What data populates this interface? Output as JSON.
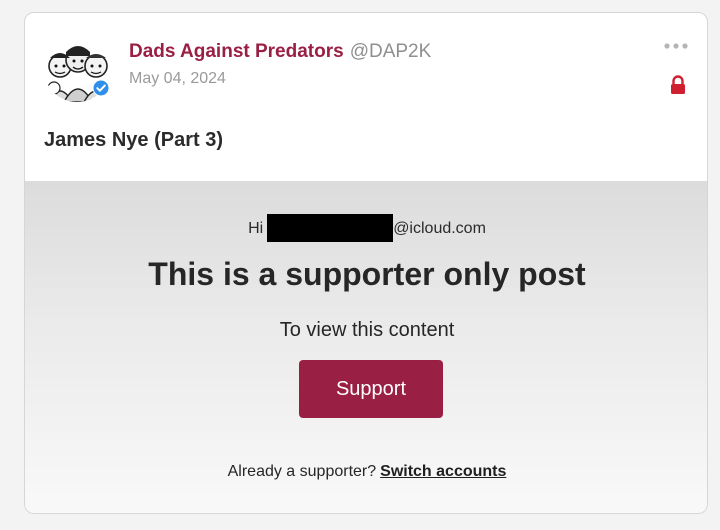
{
  "post": {
    "author_name": "Dads Against Predators",
    "handle": "@DAP2K",
    "date": "May 04, 2024",
    "title": "James Nye (Part 3)"
  },
  "paywall": {
    "greeting_prefix": "Hi",
    "email_suffix": "@icloud.com",
    "headline": "This is a supporter only post",
    "subtext": "To view this content",
    "support_button": "Support",
    "already_text": "Already a supporter?",
    "switch_link": "Switch accounts"
  },
  "icons": {
    "more": "more-horizontal-icon",
    "lock": "lock-icon",
    "verified": "verified-badge-icon"
  },
  "colors": {
    "brand": "#9a1f44",
    "verified": "#2f8ee8"
  }
}
